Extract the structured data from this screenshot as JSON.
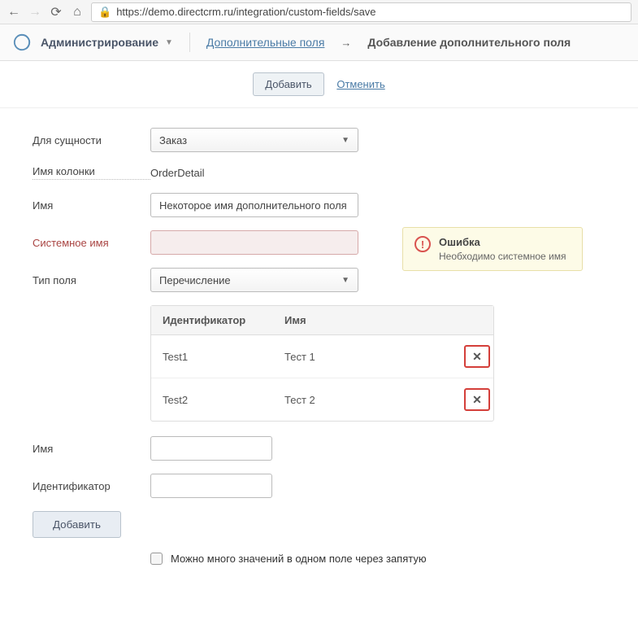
{
  "browser": {
    "url": "https://demo.directcrm.ru/integration/custom-fields/save"
  },
  "nav": {
    "admin": "Администрирование",
    "breadcrumb_link": "Дополнительные поля",
    "breadcrumb_current": "Добавление дополнительного поля"
  },
  "actions": {
    "add": "Добавить",
    "cancel": "Отменить"
  },
  "form": {
    "entity_label": "Для сущности",
    "entity_value": "Заказ",
    "column_label": "Имя колонки",
    "column_value": "OrderDetail",
    "name_label": "Имя",
    "name_value": "Некоторое имя дополнительного поля",
    "sysname_label": "Системное имя",
    "sysname_value": "",
    "type_label": "Тип поля",
    "type_value": "Перечисление",
    "item_name_label": "Имя",
    "item_id_label": "Идентификатор",
    "add_btn": "Добавить",
    "multi_label": "Можно много значений в одном поле через запятую"
  },
  "error": {
    "title": "Ошибка",
    "message": "Необходимо системное имя"
  },
  "enum": {
    "header_id": "Идентификатор",
    "header_name": "Имя",
    "rows": [
      {
        "id": "Test1",
        "name": "Тест 1"
      },
      {
        "id": "Test2",
        "name": "Тест 2"
      }
    ]
  }
}
